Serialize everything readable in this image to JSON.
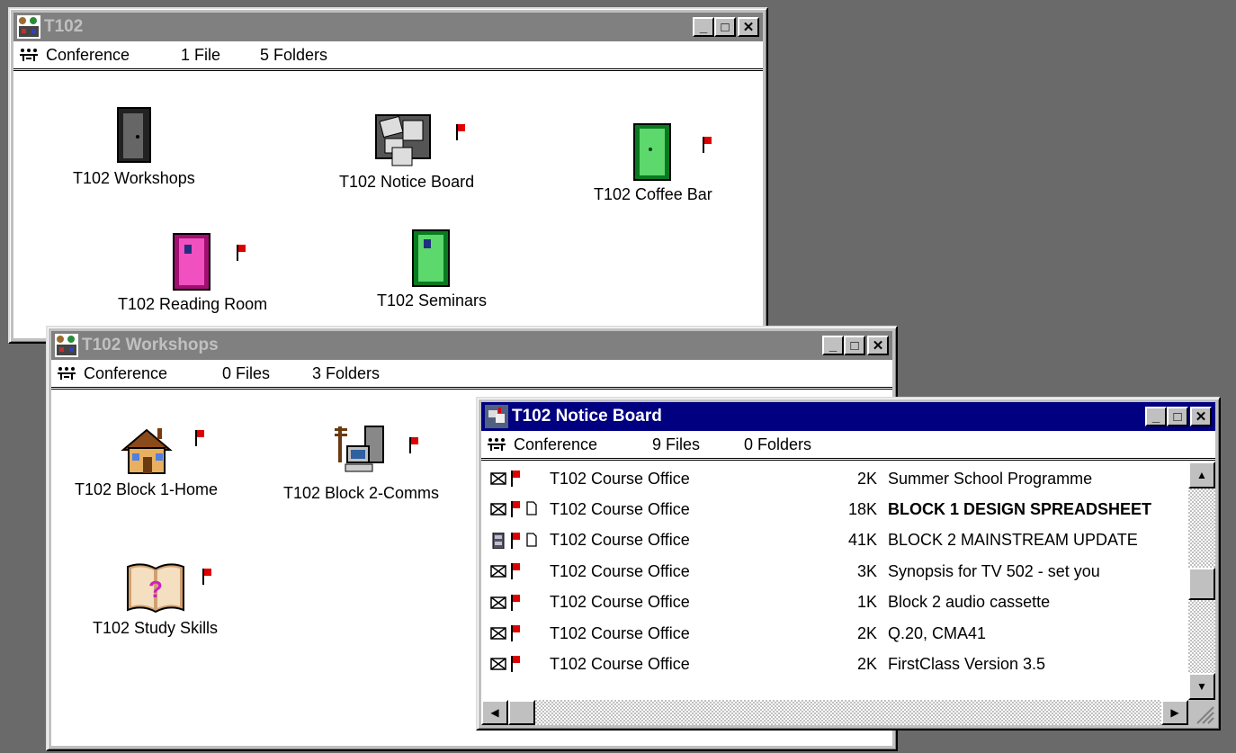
{
  "windows": {
    "t102": {
      "title": "T102",
      "status": {
        "type": "Conference",
        "files": "1 File",
        "folders": "5 Folders"
      },
      "items": [
        {
          "label": "T102 Workshops",
          "icon": "dark-door-icon"
        },
        {
          "label": "T102 Notice Board",
          "icon": "notice-board-icon"
        },
        {
          "label": "T102 Coffee Bar",
          "icon": "green-door-icon"
        },
        {
          "label": "T102 Reading Room",
          "icon": "pink-door-icon"
        },
        {
          "label": "T102 Seminars",
          "icon": "green-door-icon"
        }
      ]
    },
    "workshops": {
      "title": "T102 Workshops",
      "status": {
        "type": "Conference",
        "files": "0 Files",
        "folders": "3 Folders"
      },
      "items": [
        {
          "label": "T102 Block 1-Home",
          "icon": "house-icon"
        },
        {
          "label": "T102 Block 2-Comms",
          "icon": "computer-comms-icon"
        },
        {
          "label": "T102 Study Skills",
          "icon": "book-icon"
        }
      ]
    },
    "notice_board": {
      "title": "T102 Notice Board",
      "status": {
        "type": "Conference",
        "files": "9 Files",
        "folders": "0 Folders"
      },
      "rows": [
        {
          "sender": "T102 Course Office",
          "size": "2K",
          "subject": "Summer School Programme",
          "bold": false,
          "type": "mail",
          "attach": false
        },
        {
          "sender": "T102 Course Office",
          "size": "18K",
          "subject": "BLOCK 1 DESIGN SPREADSHEET",
          "bold": true,
          "type": "mail",
          "attach": true
        },
        {
          "sender": "T102 Course Office",
          "size": "41K",
          "subject": "BLOCK 2 MAINSTREAM UPDATE",
          "bold": false,
          "type": "cabinet",
          "attach": true
        },
        {
          "sender": "T102 Course Office",
          "size": "3K",
          "subject": "Synopsis for TV 502 - set you",
          "bold": false,
          "type": "mail",
          "attach": false
        },
        {
          "sender": "T102 Course Office",
          "size": "1K",
          "subject": "Block 2 audio cassette",
          "bold": false,
          "type": "mail",
          "attach": false
        },
        {
          "sender": "T102 Course Office",
          "size": "2K",
          "subject": "Q.20, CMA41",
          "bold": false,
          "type": "mail",
          "attach": false
        },
        {
          "sender": "T102 Course Office",
          "size": "2K",
          "subject": "FirstClass Version 3.5",
          "bold": false,
          "type": "mail",
          "attach": false
        }
      ]
    }
  },
  "colors": {
    "desktop": "#6b6a6b",
    "active_title": "#000080",
    "inactive_title": "#808080",
    "flag": "#e00000"
  }
}
